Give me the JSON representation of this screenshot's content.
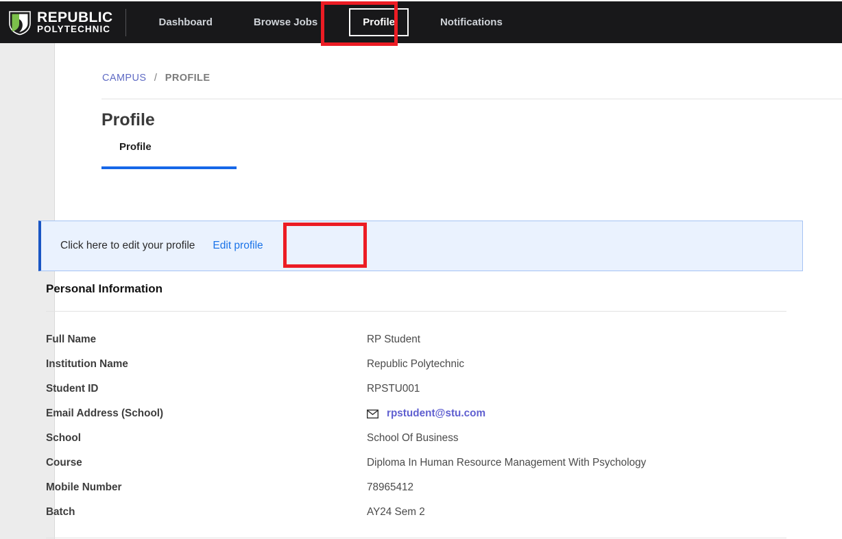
{
  "brand": {
    "line1": "REPUBLIC",
    "line2": "POLYTECHNIC",
    "logo_icon": "shield-logo-icon"
  },
  "nav": {
    "items": [
      {
        "label": "Dashboard",
        "active": false
      },
      {
        "label": "Browse Jobs",
        "active": false
      },
      {
        "label": "Profile",
        "active": true
      },
      {
        "label": "Notifications",
        "active": false
      }
    ]
  },
  "breadcrumb": {
    "root": "CAMPUS",
    "separator": "/",
    "current": "PROFILE"
  },
  "page": {
    "title": "Profile"
  },
  "tabs": [
    {
      "label": "Profile",
      "active": true
    }
  ],
  "edit_banner": {
    "text": "Click here to edit your profile",
    "link_label": "Edit profile",
    "background_color": "#eaf2fe",
    "accent_color": "#1a56c4"
  },
  "personal_information": {
    "heading": "Personal Information",
    "rows": [
      {
        "label": "Full Name",
        "value": "RP Student",
        "is_link": false,
        "icon": ""
      },
      {
        "label": "Institution Name",
        "value": "Republic Polytechnic",
        "is_link": false,
        "icon": ""
      },
      {
        "label": "Student ID",
        "value": "RPSTU001",
        "is_link": false,
        "icon": ""
      },
      {
        "label": "Email Address (School)",
        "value": "rpstudent@stu.com",
        "is_link": true,
        "icon": "envelope-icon"
      },
      {
        "label": "School",
        "value": "School Of Business",
        "is_link": false,
        "icon": ""
      },
      {
        "label": "Course",
        "value": "Diploma In Human Resource Management With Psychology",
        "is_link": false,
        "icon": ""
      },
      {
        "label": "Mobile Number",
        "value": "78965412",
        "is_link": false,
        "icon": ""
      },
      {
        "label": "Batch",
        "value": "AY24 Sem 2",
        "is_link": false,
        "icon": ""
      }
    ]
  },
  "annotations": [
    {
      "name": "profile-nav-highlight",
      "color": "#ec1c24"
    },
    {
      "name": "edit-profile-highlight",
      "color": "#ec1c24"
    }
  ],
  "colors": {
    "header_background": "#18181a",
    "tab_accent": "#1667e8",
    "link": "#1a73e8",
    "breadcrumb_link": "#5f6bc4",
    "annotation": "#ec1c24"
  }
}
